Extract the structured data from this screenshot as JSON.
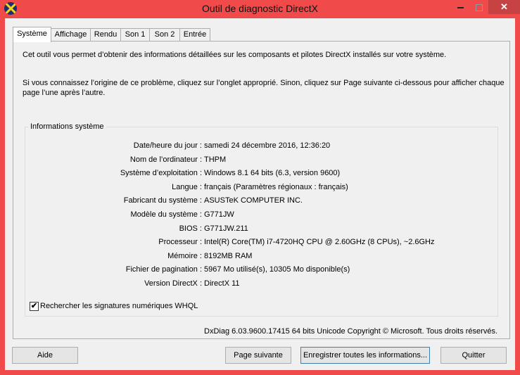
{
  "window": {
    "title": "Outil de diagnostic DirectX"
  },
  "tabs": [
    "Système",
    "Affichage",
    "Rendu",
    "Son 1",
    "Son 2",
    "Entrée"
  ],
  "intro": {
    "line1": "Cet outil vous permet d’obtenir des informations détaillées sur les composants et pilotes DirectX installés sur votre système.",
    "line2": "Si vous connaissez l’origine de ce problème, cliquez sur l’onglet approprié. Sinon, cliquez sur Page suivante ci-dessous pour afficher chaque page l’une après l’autre."
  },
  "sysinfo": {
    "title": "Informations système",
    "rows": [
      {
        "label": "Date/heure du jour :",
        "value": "samedi 24 décembre 2016, 12:36:20"
      },
      {
        "label": "Nom de l’ordinateur :",
        "value": "THPM"
      },
      {
        "label": "Système d’exploitation :",
        "value": "Windows 8.1 64 bits (6.3, version 9600)"
      },
      {
        "label": "Langue :",
        "value": "français (Paramètres régionaux : français)"
      },
      {
        "label": "Fabricant du système :",
        "value": "ASUSTeK COMPUTER INC."
      },
      {
        "label": "Modèle du système :",
        "value": "G771JW"
      },
      {
        "label": "BIOS :",
        "value": "G771JW.211"
      },
      {
        "label": "Processeur :",
        "value": "Intel(R) Core(TM) i7-4720HQ CPU @ 2.60GHz (8 CPUs), ~2.6GHz"
      },
      {
        "label": "Mémoire :",
        "value": "8192MB RAM"
      },
      {
        "label": "Fichier de pagination :",
        "value": "5967 Mo utilisé(s), 10305 Mo disponible(s)"
      },
      {
        "label": "Version DirectX :",
        "value": "DirectX 11"
      }
    ]
  },
  "whql": {
    "label": "Rechercher les signatures numériques WHQL",
    "checked": true,
    "mark": "✔"
  },
  "footer": "DxDiag 6.03.9600.17415 64 bits Unicode Copyright © Microsoft. Tous droits réservés.",
  "buttons": {
    "help": "Aide",
    "next": "Page suivante",
    "save": "Enregistrer toutes les informations...",
    "quit": "Quitter"
  },
  "colors": {
    "titlebar": "#f04a4a",
    "close": "#c74343",
    "client": "#f0f0f0"
  }
}
